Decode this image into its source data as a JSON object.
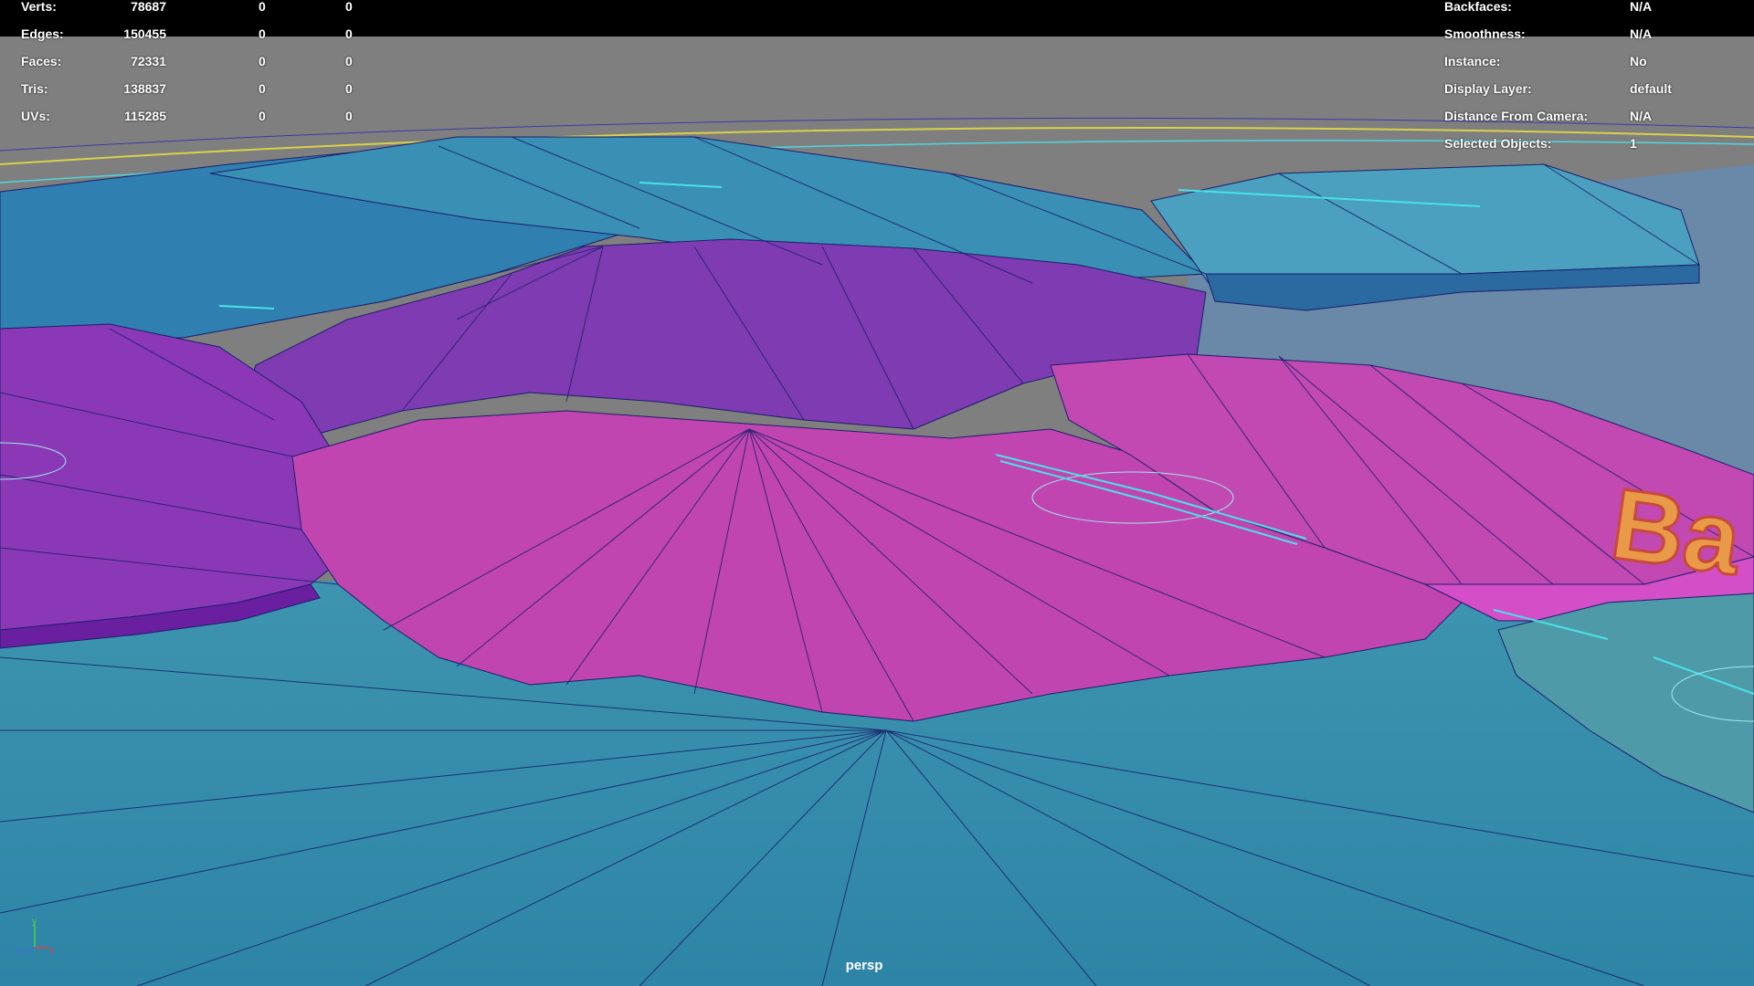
{
  "hud_left": {
    "rows": [
      {
        "label": "Verts:",
        "value": "78687",
        "selected": "0",
        "uv": "0"
      },
      {
        "label": "Edges:",
        "value": "150455",
        "selected": "0",
        "uv": "0"
      },
      {
        "label": "Faces:",
        "value": "72331",
        "selected": "0",
        "uv": "0"
      },
      {
        "label": "Tris:",
        "value": "138837",
        "selected": "0",
        "uv": "0"
      },
      {
        "label": "UVs:",
        "value": "115285",
        "selected": "0",
        "uv": "0"
      }
    ]
  },
  "hud_right": {
    "rows": [
      {
        "label": "Backfaces:",
        "value": "N/A"
      },
      {
        "label": "Smoothness:",
        "value": "N/A"
      },
      {
        "label": "Instance:",
        "value": "No"
      },
      {
        "label": "Display Layer:",
        "value": "default"
      },
      {
        "label": "Distance From Camera:",
        "value": "N/A"
      },
      {
        "label": "Selected Objects:",
        "value": "1"
      }
    ]
  },
  "camera": {
    "name": "persp"
  },
  "axes": {
    "y": "y",
    "z": "z",
    "x": "x"
  },
  "scene_text": {
    "large_label": "Ba"
  },
  "colors": {
    "ground": "#3a8bab",
    "purple_region": "#7d3bb0",
    "magenta_region": "#c146b0",
    "teal_region": "#3392b0",
    "sky": "#808080",
    "header_bar": "#000000",
    "wire": "#1b1f6b",
    "accent_text": "#e8963a",
    "highlight": "#48e2e8"
  }
}
